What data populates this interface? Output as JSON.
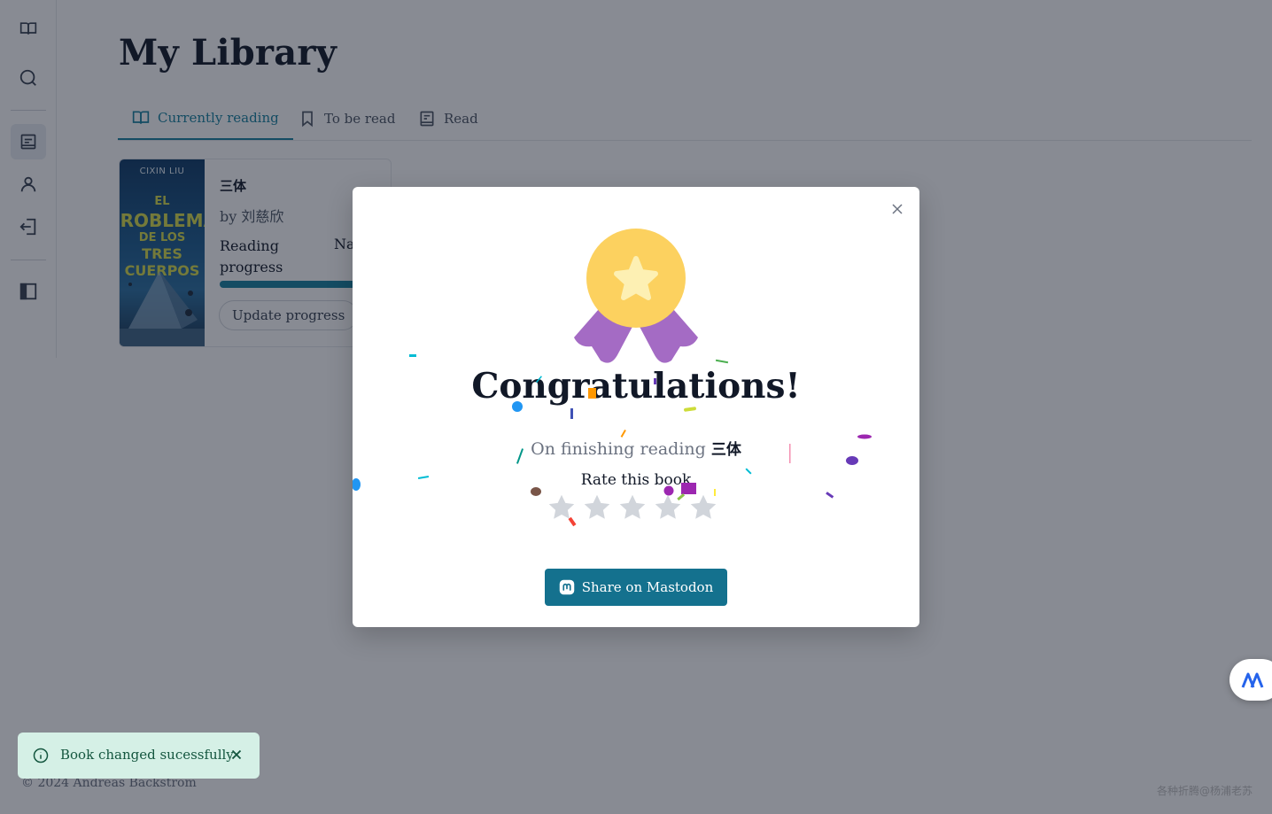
{
  "sidebar": {
    "items": [
      {
        "icon": "open-book-icon"
      },
      {
        "icon": "search-icon"
      },
      {
        "icon": "library-icon",
        "active": true
      },
      {
        "icon": "user-icon"
      },
      {
        "icon": "logout-icon"
      },
      {
        "icon": "sidebar-toggle-icon"
      }
    ]
  },
  "header": {
    "title": "My Library"
  },
  "tabs": [
    {
      "label": "Currently reading",
      "icon": "open-book-icon",
      "active": true
    },
    {
      "label": "To be read",
      "icon": "bookmark-icon"
    },
    {
      "label": "Read",
      "icon": "book-closed-icon"
    }
  ],
  "book": {
    "title": "三体",
    "author": "by 刘慈欣",
    "cover_author": "CIXIN LIU",
    "cover_lines": [
      "EL",
      "PROBLEMA",
      "DE LOS",
      "TRES CUERPOS"
    ],
    "progress_label": "Reading progress",
    "progress_value": "Na",
    "update_label": "Update progress"
  },
  "modal": {
    "title": "Congratulations!",
    "subtitle_prefix": "On finishing reading",
    "subtitle_book": "三体",
    "rate_label": "Rate this book",
    "stars_total": 5,
    "stars_selected": 0,
    "share_label": "Share on Mastodon",
    "colors": {
      "medal": "#fcd15f",
      "ribbon": "#a46bc4",
      "share": "#14718e",
      "star_empty": "#d1d5db"
    }
  },
  "toast": {
    "message": "Book changed sucessfully"
  },
  "footer": {
    "copyright": "© 2024 Andreas Backström"
  },
  "watermark": "各种折腾@杨浦老苏"
}
